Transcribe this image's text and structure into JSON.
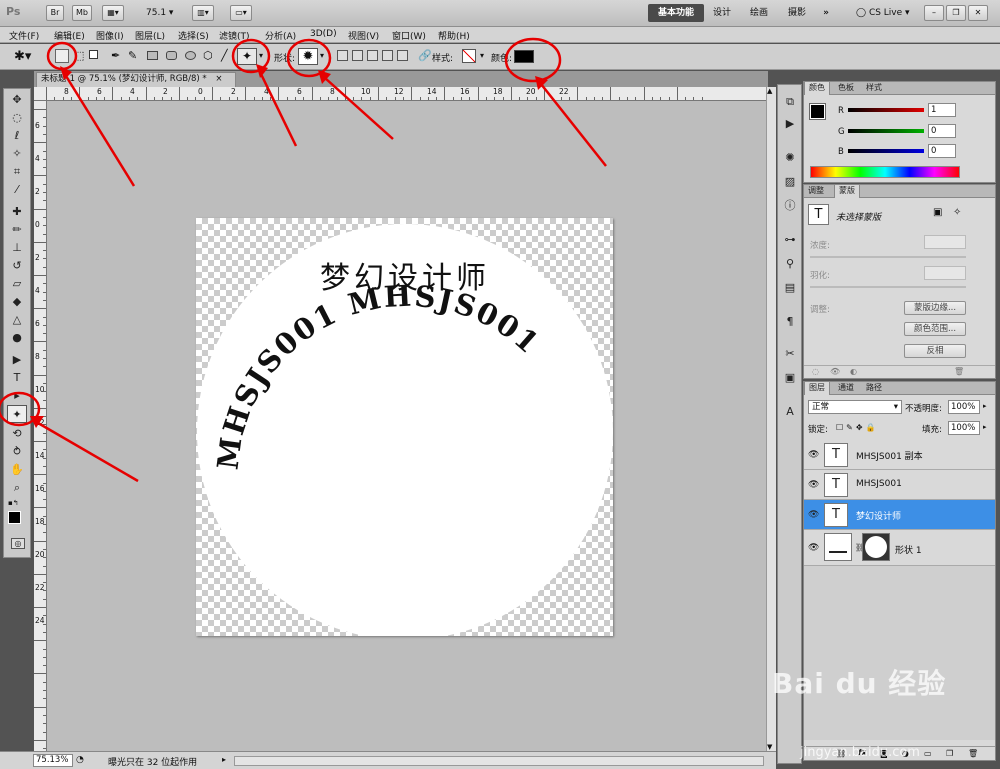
{
  "titlebar": {
    "logo": "Ps",
    "br_label": "Br",
    "mb_label": "Mb",
    "zoom_value": "75.1",
    "workspaces": [
      "基本功能",
      "设计",
      "绘画",
      "摄影"
    ],
    "more": "»",
    "cslive": "CS Live"
  },
  "menu": [
    "文件(F)",
    "编辑(E)",
    "图像(I)",
    "图层(L)",
    "选择(S)",
    "滤镜(T)",
    "分析(A)",
    "3D(D)",
    "视图(V)",
    "窗口(W)",
    "帮助(H)"
  ],
  "options": {
    "shape_label": "形状:",
    "style_label": "样式:",
    "color_label": "颜色:",
    "color_value": "#000000"
  },
  "document": {
    "tab_label": "未标题-1 @ 75.1% (梦幻设计师, RGB/8) *",
    "close": "×",
    "curve_text": "MHSJS001 MHSJS001",
    "center_text": "梦幻设计师"
  },
  "ruler_h": [
    "8",
    "6",
    "4",
    "2",
    "0",
    "2",
    "4",
    "6",
    "8",
    "10",
    "12",
    "14",
    "16",
    "18",
    "20",
    "22"
  ],
  "ruler_v": [
    "6",
    "4",
    "2",
    "0",
    "2",
    "4",
    "6",
    "8",
    "10",
    "12",
    "14",
    "16",
    "18",
    "20",
    "22",
    "24"
  ],
  "status": {
    "zoom": "75.13%",
    "message": "曝光只在 32 位起作用"
  },
  "color_panel": {
    "tabs": [
      "颜色",
      "色板",
      "样式"
    ],
    "r_label": "R",
    "g_label": "G",
    "b_label": "B",
    "r": "1",
    "g": "0",
    "b": "0",
    "red": "#e00000",
    "green": "#00b000",
    "blue": "#0000e0"
  },
  "adjust_panel": {
    "tabs": [
      "调整",
      "蒙版"
    ],
    "no_mask": "未选择蒙版",
    "density": "浓度:",
    "feather": "羽化:",
    "refine": "调整:",
    "mask_edge": "蒙版边缘...",
    "color_range": "颜色范围...",
    "invert": "反相"
  },
  "layers_panel": {
    "tabs": [
      "图层",
      "通道",
      "路径"
    ],
    "blend_mode": "正常",
    "opacity_label": "不透明度:",
    "opacity": "100%",
    "lock_label": "锁定:",
    "fill_label": "填充:",
    "fill": "100%",
    "layers": [
      {
        "name": "MHSJS001 副本",
        "thumb": "T"
      },
      {
        "name": "MHSJS001",
        "thumb": "T"
      },
      {
        "name": "梦幻设计师",
        "thumb": "T",
        "selected": true
      },
      {
        "name": "形状 1",
        "thumb": "shape"
      }
    ]
  },
  "watermark": {
    "brand": "Bai du 经验",
    "url": "jingyan.baidu.com"
  }
}
